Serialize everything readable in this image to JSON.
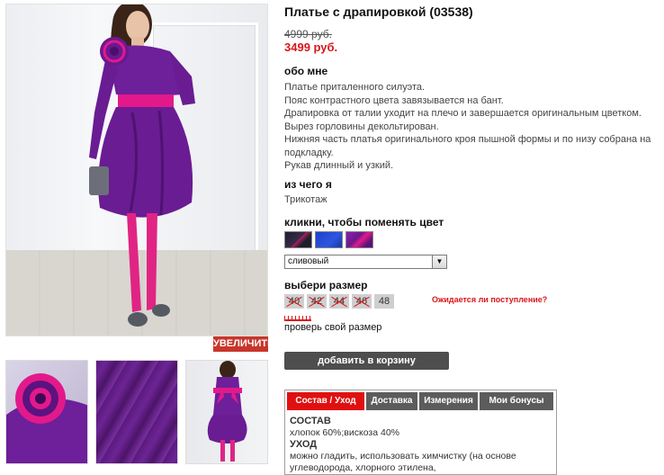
{
  "product": {
    "title": "Платье с драпировкой (03538)",
    "old_price": "4999 руб.",
    "new_price": "3499 руб."
  },
  "gallery": {
    "zoom_label": "УВЕЛИЧИТЬ"
  },
  "about": {
    "heading": "обо мне",
    "lines": [
      "Платье приталенного силуэта.",
      "Пояс контрастного цвета завязывается на бант.",
      "Драпировка от талии уходит на плечо и завершается оригинальным цветком.",
      "Вырез горловины декольтирован.",
      "Нижняя часть платья оригинального кроя пышной формы и по низу собрана на",
      "подкладку.",
      "Рукав длинный и узкий."
    ]
  },
  "material": {
    "heading": "из чего я",
    "value": "Трикотаж"
  },
  "color": {
    "heading": "кликни, чтобы поменять цвет",
    "selected": "сливовый",
    "colors": {
      "dress": "#6e1f9a",
      "belt": "#e3198b",
      "blue_swatch": "#1f3fc8"
    }
  },
  "size": {
    "heading": "выбери размер",
    "sizes": [
      {
        "label": "40",
        "available": false
      },
      {
        "label": "42",
        "available": false
      },
      {
        "label": "44",
        "available": false
      },
      {
        "label": "46",
        "available": false
      },
      {
        "label": "48",
        "available": true
      }
    ],
    "await_link": "Ожидается ли поступление?",
    "check_size": "проверь свой размер"
  },
  "cart": {
    "add_label": "добавить в корзину"
  },
  "tabs": {
    "items": [
      "Состав / Уход",
      "Доставка",
      "Измерения",
      "Мои бонусы"
    ],
    "active": 0,
    "content": {
      "composition_heading": "СОСТАВ",
      "composition": "хлопок 60%;вискоза 40%",
      "care_heading": "УХОД",
      "care_line1": "можно гладить, использовать химчистку (на основе",
      "care_line2": "углеводорода, хлорного этилена,"
    }
  },
  "accent_color": "#d8161a"
}
